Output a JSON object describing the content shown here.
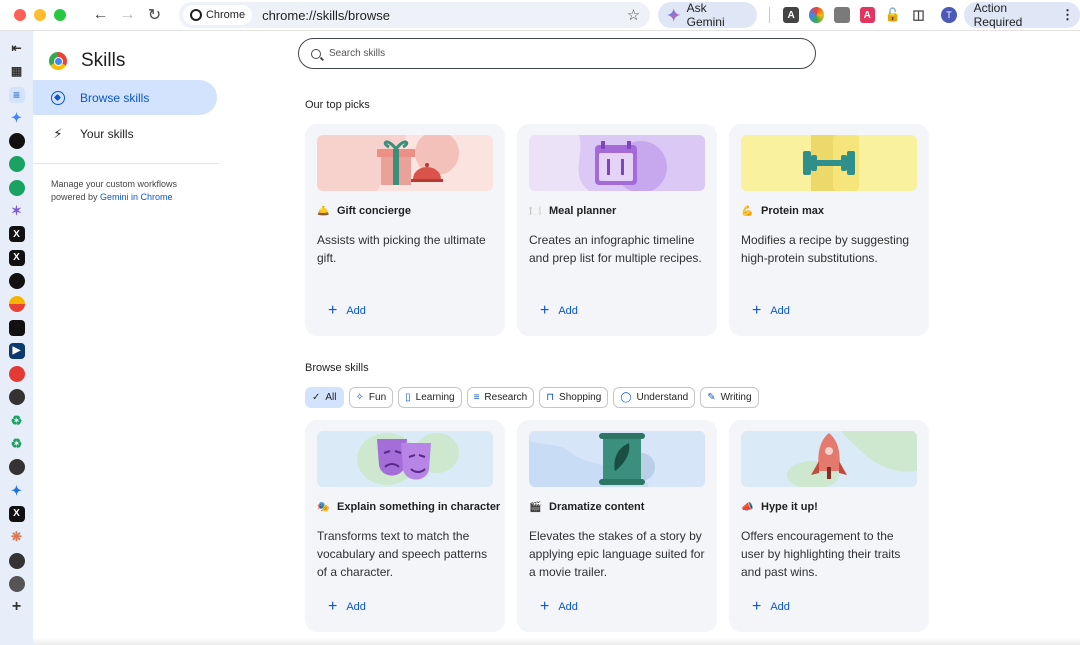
{
  "browser": {
    "tab_chip_label": "Chrome",
    "url": "chrome://skills/browse",
    "ask_gemini_label": "Ask Gemini",
    "profile_initial": "T",
    "action_required_label": "Action Required",
    "ext_letter_a": "A"
  },
  "sidebar": {
    "title": "Skills",
    "items": [
      {
        "label": "Browse skills",
        "active": true
      },
      {
        "label": "Your skills",
        "active": false
      }
    ],
    "footer_text": "Manage your custom workflows powered by ",
    "footer_link": "Gemini in Chrome"
  },
  "search": {
    "placeholder": "Search skills"
  },
  "top_picks": {
    "heading": "Our top picks",
    "cards": [
      {
        "emoji": "🛎️",
        "title": "Gift concierge",
        "description": "Assists with picking the ultimate gift.",
        "add_label": "Add"
      },
      {
        "emoji": "🍽️",
        "title": "Meal planner",
        "description": "Creates an infographic timeline and prep list for multiple recipes.",
        "add_label": "Add"
      },
      {
        "emoji": "💪",
        "title": "Protein max",
        "description": "Modifies a recipe by suggesting high-protein substitutions.",
        "add_label": "Add"
      }
    ]
  },
  "browse": {
    "heading": "Browse skills",
    "filters": [
      {
        "label": "All",
        "icon": "✓",
        "selected": true
      },
      {
        "label": "Fun",
        "icon": "✧",
        "selected": false
      },
      {
        "label": "Learning",
        "icon": "▯",
        "selected": false
      },
      {
        "label": "Research",
        "icon": "≡",
        "selected": false
      },
      {
        "label": "Shopping",
        "icon": "⊓",
        "selected": false
      },
      {
        "label": "Understand",
        "icon": "◯",
        "selected": false
      },
      {
        "label": "Writing",
        "icon": "✎",
        "selected": false
      }
    ],
    "cards": [
      {
        "emoji": "🎭",
        "title": "Explain something in character",
        "description": "Transforms text to match the vocabulary and speech patterns of a character.",
        "add_label": "Add"
      },
      {
        "emoji": "🎬",
        "title": "Dramatize content",
        "description": "Elevates the stakes of a story by applying epic language suited for a movie trailer.",
        "add_label": "Add"
      },
      {
        "emoji": "📣",
        "title": "Hype it up!",
        "description": "Offers encouragement to the user by highlighting their traits and past wins.",
        "add_label": "Add"
      }
    ]
  },
  "colors": {
    "accent": "#0b57d0",
    "active_nav_bg": "#d3e3fd",
    "card_bg": "#f3f5f9"
  }
}
